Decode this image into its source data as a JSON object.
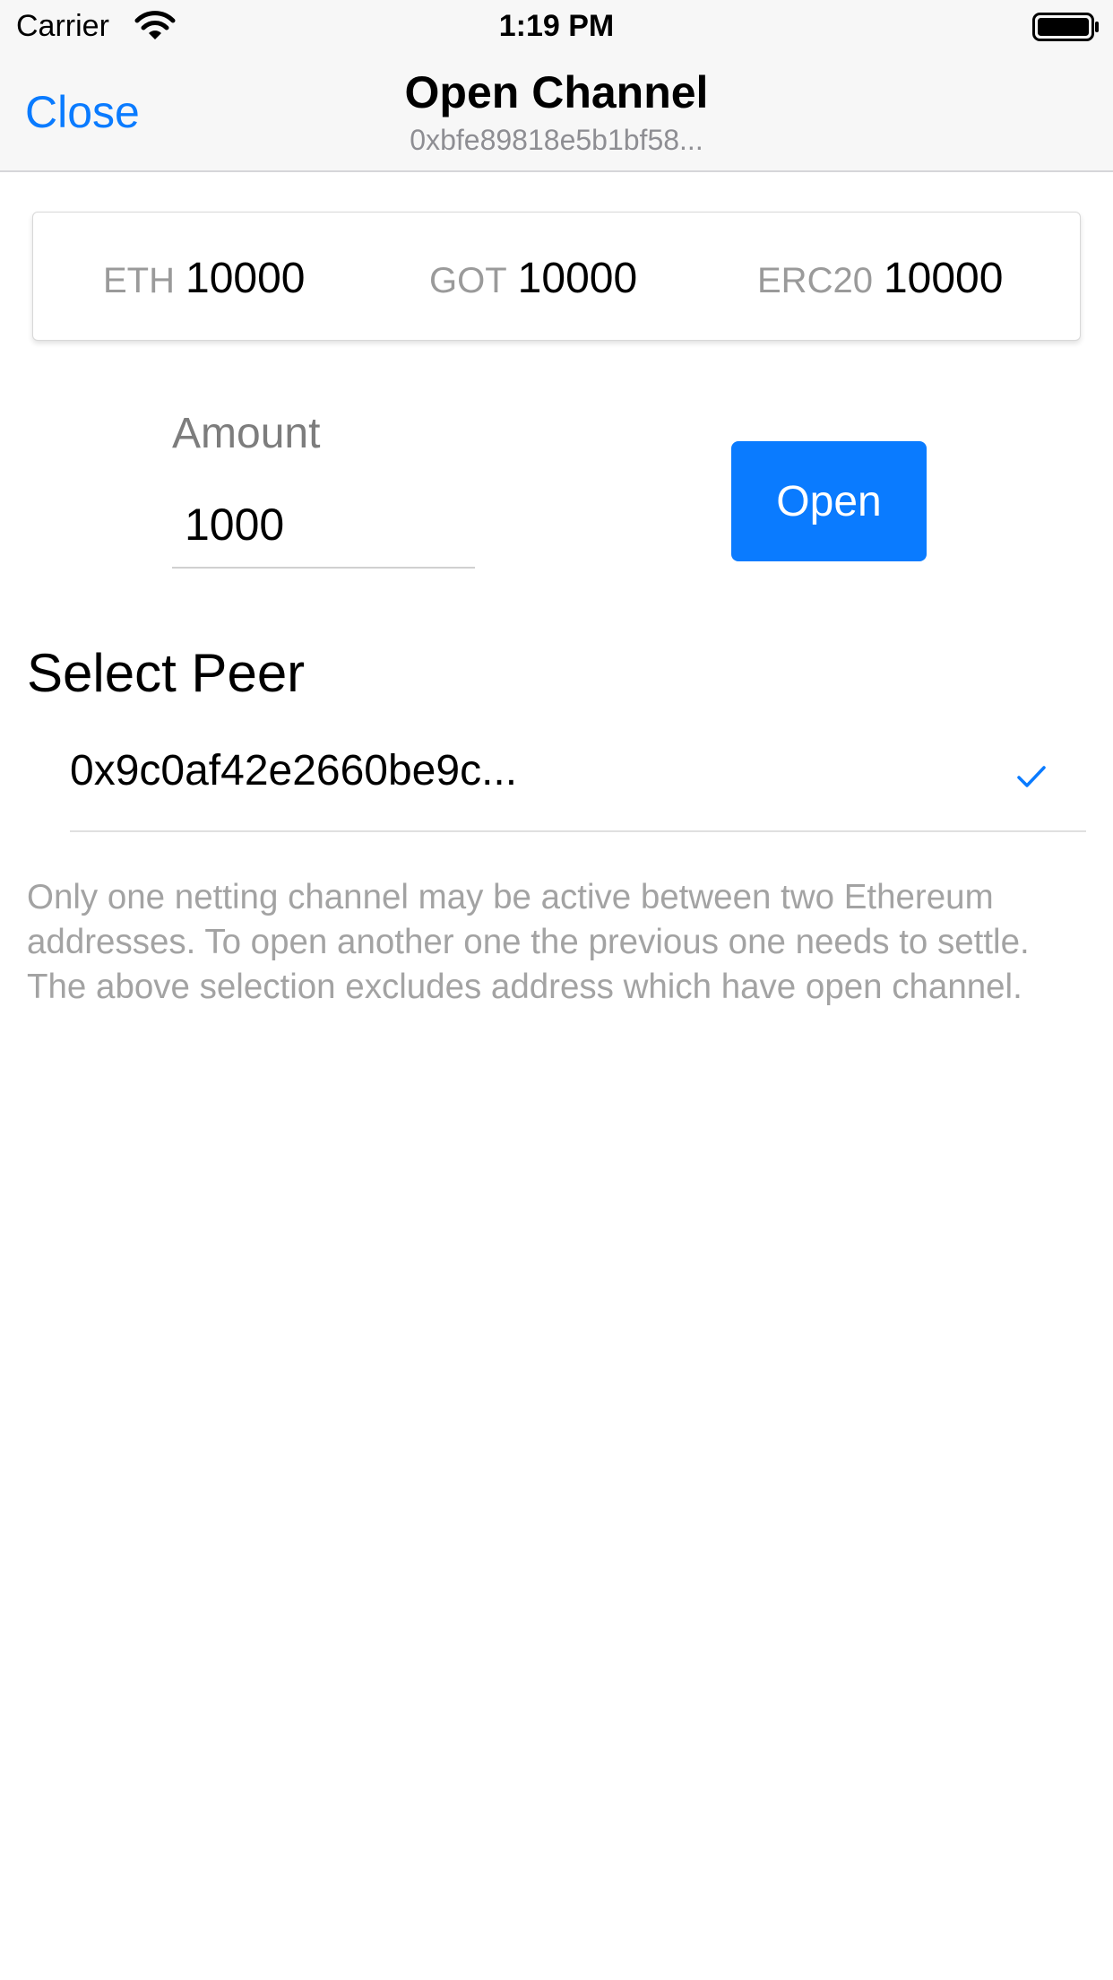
{
  "status_bar": {
    "carrier": "Carrier",
    "time": "1:19 PM",
    "wifi_icon": "wifi-icon",
    "battery_icon": "battery-icon"
  },
  "nav": {
    "close_label": "Close",
    "title": "Open Channel",
    "subtitle": "0xbfe89818e5b1bf58..."
  },
  "balances": [
    {
      "label": "ETH",
      "value": "10000"
    },
    {
      "label": "GOT",
      "value": "10000"
    },
    {
      "label": "ERC20",
      "value": "10000"
    }
  ],
  "amount": {
    "label": "Amount",
    "value": "1000"
  },
  "open_button": {
    "label": "Open"
  },
  "select_peer": {
    "heading": "Select Peer",
    "peers": [
      {
        "address": "0x9c0af42e2660be9c...",
        "selected": true,
        "icon": "checkmark-icon"
      }
    ]
  },
  "help_text": "Only one netting channel may be active between two Ethereum addresses. To open another one the previous one needs to settle. The above selection excludes address which have open channel.",
  "colors": {
    "accent": "#0a7bff",
    "secondary_text": "#a3a3a3",
    "bar_background": "#f7f7f7"
  }
}
